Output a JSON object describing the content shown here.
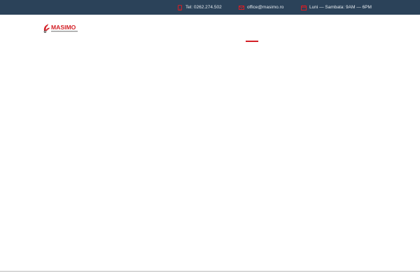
{
  "topbar": {
    "phone_text": "Tel: 0262.274.502",
    "email_text": "office@masimo.ro",
    "hours_text": "Luni — Sambata: 9AM — 6PM",
    "background_color": "#2b4259",
    "icon_color": "#d31f26"
  },
  "header": {
    "logo_text": "MASIMO",
    "brand_color": "#d31f26"
  }
}
